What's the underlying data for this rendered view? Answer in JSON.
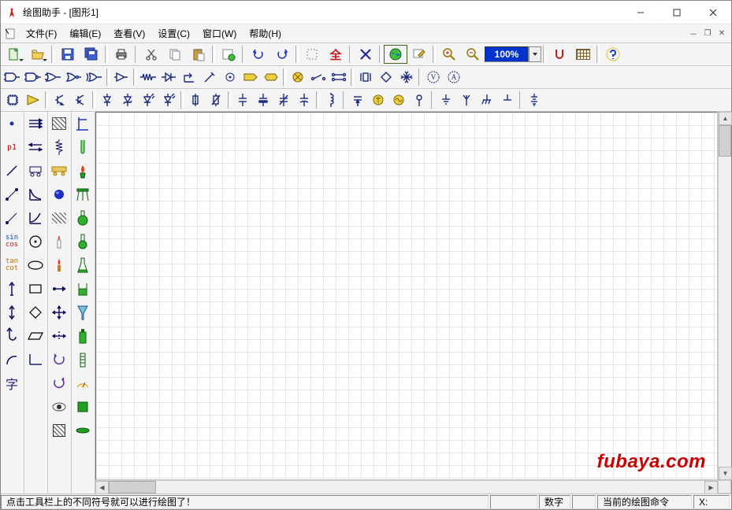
{
  "title": "绘图助手 - [图形1]",
  "menu": {
    "file": "文件(F)",
    "edit": "编辑(E)",
    "view": "查看(V)",
    "settings": "设置(C)",
    "window": "窗口(W)",
    "help": "帮助(H)"
  },
  "toolbar": {
    "new": "新建",
    "open": "打开",
    "save": "保存",
    "saveall": "全部保存",
    "print": "打印",
    "cut": "剪切",
    "copy": "复制",
    "paste": "粘贴",
    "undo": "撤销",
    "redo": "重做",
    "zoom": "100%"
  },
  "status": {
    "hint": "点击工具栏上的不同符号就可以进行绘图了！",
    "numlock": "数字",
    "cmd": "当前的绘图命令",
    "xlabel": "X:"
  },
  "watermark": "fubaya.com",
  "left": {
    "label_p1": "p1",
    "label_sin": "sin",
    "label_cos": "cos",
    "label_tan": "tan",
    "label_cot": "cot",
    "label_zi": "字"
  }
}
